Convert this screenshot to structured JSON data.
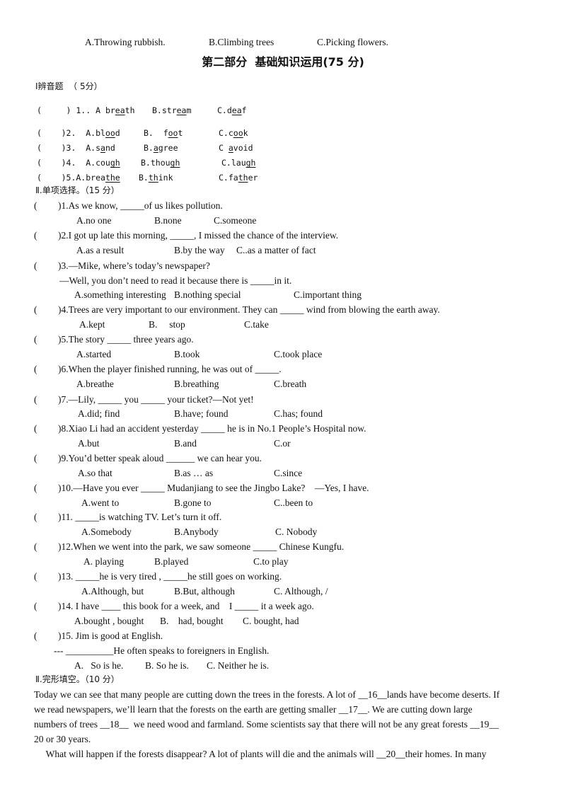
{
  "prev_options": {
    "a": "A.Throwing rubbish.",
    "b": "B.Climbing trees",
    "c": "C.Picking flowers."
  },
  "part_title": "第二部分  基础知识运用(75 分)",
  "section1": {
    "heading": "Ⅰ辨音题  （ 5分）",
    "items": [
      {
        "prefix": "(     ) 1.. A ",
        "a_pre": "br",
        "a_u": "ea",
        "a_post": "th",
        "b_pre": "B.str",
        "b_u": "ea",
        "b_post": "m",
        "c_pre": "C.d",
        "c_u": "ea",
        "c_post": "f"
      },
      {
        "prefix": "(    )2.  A.bl",
        "a_u": "oo",
        "a_post": "d",
        "b_pre": "B.  f",
        "b_u": "oo",
        "b_post": "t",
        "c_pre": "C.c",
        "c_u": "oo",
        "c_post": "k"
      },
      {
        "prefix": "(    )3.  A.s",
        "a_u": "a",
        "a_post": "nd",
        "b_pre": "B.",
        "b_u": "a",
        "b_post": "gree",
        "c_pre": "C ",
        "c_u": "a",
        "c_post": "void"
      },
      {
        "prefix": "(    )4.  A.cou",
        "a_u": "gh",
        "a_post": "",
        "b_pre": "B.thou",
        "b_u": "gh",
        "b_post": "",
        "c_pre": "C.lau",
        "c_u": "gh",
        "c_post": ""
      },
      {
        "prefix": "(    )5.A.brea",
        "a_u": "the",
        "a_post": "",
        "b_pre": "B.",
        "b_u": "th",
        "b_post": "ink",
        "c_pre": "C.fa",
        "c_u": "th",
        "c_post": "er"
      }
    ]
  },
  "section2": {
    "heading": "Ⅱ.单项选择。（15 分）",
    "questions": [
      {
        "stem": ")1.As we know, _____of us likes pollution.",
        "opts": [
          "A.no one",
          "B.none",
          "C.someone"
        ]
      },
      {
        "stem": ")2.I got up late this morning, _____, I missed the chance of the interview.",
        "opts": [
          "A.as a result",
          "B.by the way",
          "C..as a matter of fact"
        ]
      },
      {
        "stem": ")3.—Mike, where’s today’s newspaper?",
        "stem2": "—Well, you don’t need to read it because there is _____in it.",
        "opts": [
          "A.something interesting",
          "B.nothing special",
          "C.important thing"
        ]
      },
      {
        "stem": ")4.Trees are very important to our environment. They can _____ wind from blowing the earth away.",
        "opts": [
          "A.kept",
          "B.     stop",
          "C.take"
        ]
      },
      {
        "stem": ")5.The story _____ three years ago.",
        "opts": [
          "A.started",
          "B.took",
          "C.took place"
        ]
      },
      {
        "stem": ")6.When the player finished running, he was out of _____.",
        "opts": [
          "A.breathe",
          "B.breathing",
          "C.breath"
        ]
      },
      {
        "stem": ")7.—Lily, _____ you _____ your ticket?—Not yet!",
        "opts": [
          "A.did; find",
          "B.have; found",
          "C.has; found"
        ]
      },
      {
        "stem": ")8.Xiao Li had an accident yesterday _____ he is in No.1 People’s Hospital now.",
        "opts": [
          "A.but",
          "B.and",
          "C.or"
        ]
      },
      {
        "stem": ")9.You’d better speak aloud ______ we can hear you.",
        "opts": [
          "A.so that",
          "B.as … as",
          "C.since"
        ]
      },
      {
        "stem": ")10.—Have you ever _____ Mudanjiang to see the Jingbo Lake?    —Yes, I have.",
        "opts": [
          "A.went to",
          "B.gone to",
          "C..been to"
        ]
      },
      {
        "stem": ")11. _____is watching TV. Let’s turn it off.",
        "opts": [
          "A.Somebody",
          "B.Anybody",
          "C. Nobody"
        ]
      },
      {
        "stem": ")12.When we went into the park, we saw someone _____ Chinese Kungfu.",
        "opts": [
          "A. playing",
          "B.played",
          "C.to play"
        ]
      },
      {
        "stem": ")13. _____he is very tired , _____he still goes on working.",
        "opts": [
          "A.Although, but",
          "B.But, although",
          "C. Although, /"
        ]
      },
      {
        "stem": ")14. I have ____ this book for a week, and    I _____ it a week ago.",
        "opts": [
          "A.bought , bought",
          "B.    had, bought",
          "C. bought, had"
        ]
      },
      {
        "stem": ")15. Jim is good at English.",
        "stem2": "--- __________He often speaks to foreigners in English.",
        "opts": [
          "A.   So is he.",
          "B. So he is.",
          "C. Neither he is."
        ]
      }
    ],
    "paren": "("
  },
  "section3": {
    "heading": "Ⅱ.完形填空。（10 分）",
    "lines": [
      {
        "pre": "Today we can see that many people are cutting down the trees in the forests. A lot of ",
        "blank": "__16__",
        "post": "lands have become deserts. If"
      },
      {
        "pre": "we read newspapers, we’ll learn that the forests on the earth are getting smaller ",
        "blank": "__17__",
        "post": ". We are cutting down large"
      },
      {
        "pre": "numbers of trees ",
        "blank": "__18__",
        "post": "  we need wood and farmland. Some scientists say that there will not be any great forests ",
        "blank2": "__19__"
      },
      {
        "pre": "20 or 30 years."
      },
      {
        "pre": "     What will happen if the forests disappear? A lot of plants will die and the animals will ",
        "blank": "__20__",
        "post": "their homes. In many"
      }
    ]
  }
}
